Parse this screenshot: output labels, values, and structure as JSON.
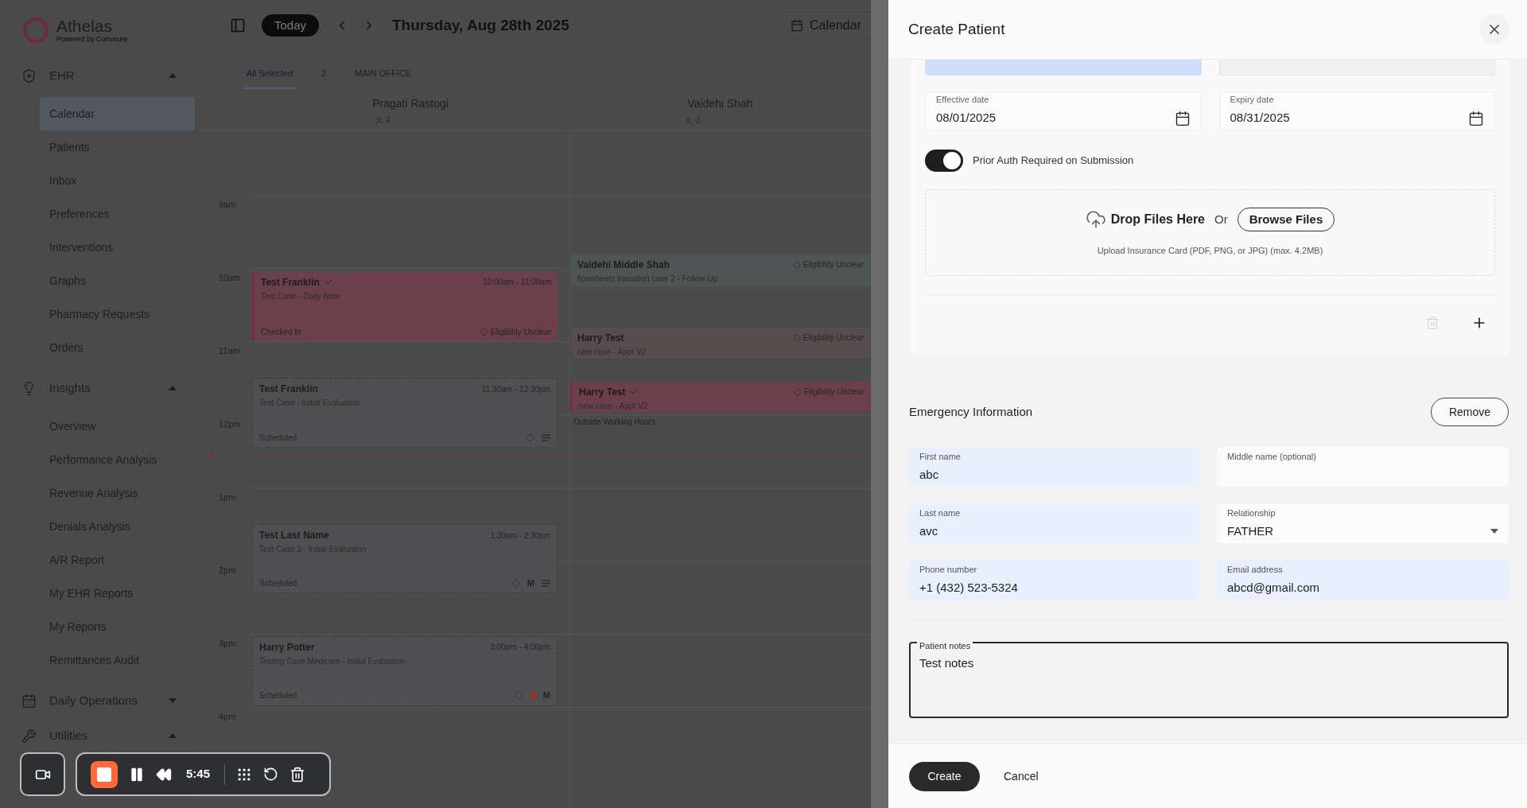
{
  "sidebar": {
    "logo": {
      "name": "Athelas",
      "tagline": "Powered by Commure"
    },
    "sections": [
      {
        "label": "EHR",
        "expanded": true,
        "items": [
          {
            "label": "Calendar",
            "selected": true
          },
          {
            "label": "Patients",
            "selected": false
          },
          {
            "label": "Inbox",
            "selected": false
          },
          {
            "label": "Preferences",
            "selected": false
          },
          {
            "label": "Interventions",
            "selected": false
          },
          {
            "label": "Graphs",
            "selected": false
          },
          {
            "label": "Pharmacy Requests",
            "selected": false
          },
          {
            "label": "Orders",
            "selected": false
          }
        ]
      },
      {
        "label": "Insights",
        "expanded": true,
        "items": [
          {
            "label": "Overview",
            "selected": false
          },
          {
            "label": "Performance Analysis",
            "selected": false
          },
          {
            "label": "Revenue Analysis",
            "selected": false
          },
          {
            "label": "Denials Analysis",
            "selected": false
          },
          {
            "label": "A/R Report",
            "selected": false
          },
          {
            "label": "My EHR Reports",
            "selected": false
          },
          {
            "label": "My Reports",
            "selected": false
          },
          {
            "label": "Remittances Audit",
            "selected": false
          }
        ]
      },
      {
        "label": "Daily Operations",
        "expanded": false
      },
      {
        "label": "Utilities",
        "expanded": true
      }
    ]
  },
  "calendar": {
    "today_button": "Today",
    "date": "Thursday, Aug 28th 2025",
    "view_button": "Calendar",
    "filters": [
      {
        "label": "All Selected",
        "selected": true
      },
      {
        "label": "2",
        "selected": false
      },
      {
        "label": "MAIN OFFICE",
        "selected": false
      }
    ],
    "hours": [
      "9am",
      "10am",
      "11am",
      "12pm",
      "1pm",
      "2pm",
      "3pm",
      "4pm"
    ],
    "providers": [
      {
        "name": "Pragati Rastogi",
        "count": "4",
        "events": [
          {
            "kind": "checked_in",
            "patient": "Test Franklin",
            "checked": true,
            "time": "10:00am - 11:00am",
            "case": "Test Case - Daily Note",
            "status": "Checked In",
            "eligibility": "Eligibility Unclear"
          },
          {
            "kind": "scheduled",
            "patient": "Test Franklin",
            "checked": false,
            "time": "11:30am - 12:30pm",
            "case": "Test Case - Initial Evaluation",
            "status": "Scheduled",
            "markers": [
              {
                "kind": "eligibility"
              },
              {
                "kind": "notes"
              }
            ]
          },
          {
            "kind": "scheduled",
            "patient": "Test Last Name",
            "checked": false,
            "time": "1:30pm - 2:30pm",
            "case": "Test Case 3 - Initial Evaluation",
            "status": "Scheduled",
            "markers": [
              {
                "kind": "eligibility"
              },
              {
                "kind": "letter",
                "text": "M"
              },
              {
                "kind": "notes"
              }
            ]
          },
          {
            "kind": "scheduled",
            "patient": "Harry Potter",
            "checked": false,
            "time": "3:00pm - 4:00pm",
            "case": "Testing Case Medicare - Initial Evaluation",
            "status": "Scheduled",
            "markers": [
              {
                "kind": "eligibility"
              },
              {
                "kind": "billing",
                "text": "$"
              },
              {
                "kind": "letter",
                "text": "M"
              }
            ]
          }
        ]
      },
      {
        "name": "Vaidehi Shah",
        "count": "3",
        "note": "Outside Working Hours",
        "events": [
          {
            "kind": "follow_up",
            "patient": "Vaidehi Middle Shah",
            "checked": false,
            "case": "flowsheets transition case 2 - Follow Up",
            "eligibility": "Eligibility Unclear"
          },
          {
            "kind": "unconfirmed",
            "patient": "Harry Test",
            "checked": false,
            "case": "new case - Appt V2",
            "eligibility": "Eligibility Unclear"
          },
          {
            "kind": "checked_in",
            "patient": "Harry Test",
            "checked": true,
            "case": "new case - Appt V2",
            "eligibility": "Eligibility Unclear"
          }
        ]
      }
    ]
  },
  "drawer": {
    "title": "Create Patient",
    "partial_fields": [
      {
        "autofilled": true
      },
      {
        "autofilled": false
      }
    ],
    "dates": [
      {
        "label": "Effective date",
        "value": "08/01/2025"
      },
      {
        "label": "Expiry date",
        "value": "08/31/2025"
      }
    ],
    "prior_auth": {
      "label": "Prior Auth Required on Submission",
      "on": true
    },
    "upload": {
      "drop_text": "Drop Files Here",
      "or": "Or",
      "browse_button": "Browse Files",
      "hint": "Upload Insurance Card (PDF, PNG, or JPG) (max. 4.2MB)"
    },
    "emergency": {
      "title": "Emergency Information",
      "remove_button": "Remove",
      "fields": [
        {
          "kind": "text",
          "label": "First name",
          "value": "abc",
          "autofilled": true
        },
        {
          "kind": "text",
          "label": "Middle name (optional)",
          "autofilled": false
        },
        {
          "kind": "text",
          "label": "Last name",
          "value": "avc",
          "autofilled": true
        },
        {
          "kind": "select",
          "label": "Relationship",
          "value": "FATHER",
          "autofilled": false
        },
        {
          "kind": "text",
          "label": "Phone number",
          "value": "+1 (432) 523-5324",
          "autofilled": true
        },
        {
          "kind": "text",
          "label": "Email address",
          "value": "abcd@gmail.com",
          "autofilled": true
        }
      ]
    },
    "notes": {
      "label": "Patient notes",
      "value": "Test notes"
    },
    "footer": {
      "create_button": "Create",
      "cancel_button": "Cancel"
    }
  },
  "recorder": {
    "time": "5:45"
  }
}
